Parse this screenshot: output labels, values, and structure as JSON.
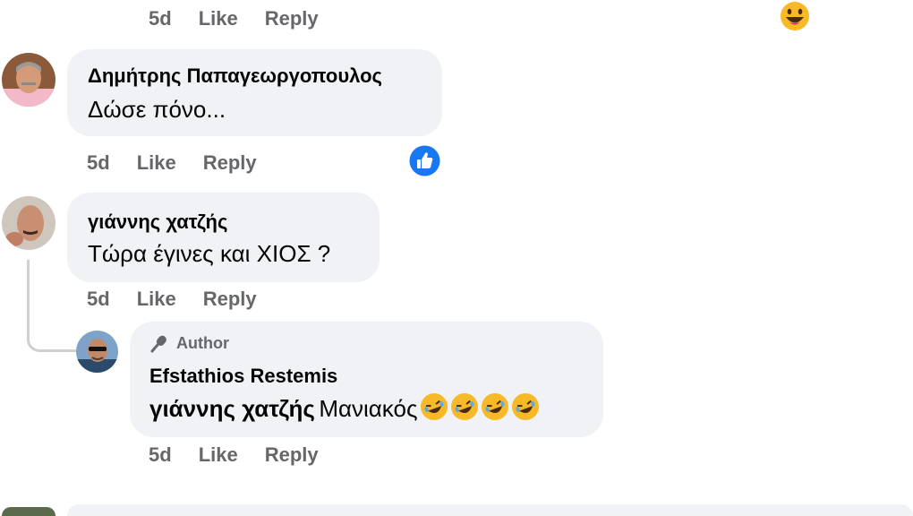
{
  "top_actions": {
    "time": "5d",
    "like": "Like",
    "reply": "Reply"
  },
  "comments": [
    {
      "author": "Δημήτρης Παπαγεωργοπουλος",
      "text": "Δώσε πόνο...",
      "time": "5d",
      "like": "Like",
      "reply": "Reply",
      "reaction": "like-reaction-icon"
    },
    {
      "author": "γιάννης χατζής",
      "text": "Τώρα έγινες και ΧΙΟΣ ?",
      "time": "5d",
      "like": "Like",
      "reply": "Reply"
    }
  ],
  "reply": {
    "badge": "Author",
    "author": "Efstathios Restemis",
    "mention": "γιάννης χατζής",
    "text": "Μανιακός",
    "emojis": [
      "rolling-on-floor-laughing-emoji",
      "rolling-on-floor-laughing-emoji",
      "rolling-on-floor-laughing-emoji",
      "rolling-on-floor-laughing-emoji"
    ],
    "time": "5d",
    "like": "Like",
    "reply": "Reply"
  },
  "colors": {
    "bubble": "#f0f2f5",
    "meta_text": "#65676b",
    "like_blue": "#1877f2",
    "emoji_yellow": "#f7b928"
  }
}
